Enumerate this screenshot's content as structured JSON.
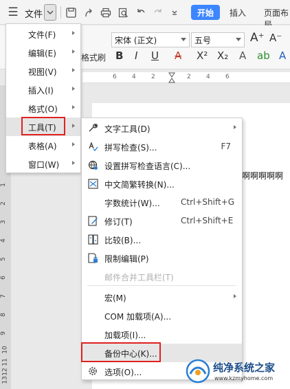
{
  "toolbar": {
    "file_label": "文件",
    "start_tab": "开始",
    "insert_tab": "插入",
    "layout_tab": "页面布局",
    "accent_color": "#3c86ff"
  },
  "ribbon": {
    "font_name": "宋体 (正文)",
    "font_size": "五号",
    "format_brush_label": "格式刷",
    "bold": "B",
    "italic": "I",
    "underline": "U",
    "grow_font": "A⁺",
    "shrink_font": "A⁻",
    "superscript": "X²",
    "subscript": "X₂"
  },
  "ruler": {
    "h_ticks": [
      "6",
      "4",
      "2",
      "2",
      "4",
      "6"
    ],
    "v_ticks": [
      "1",
      "2",
      "3",
      "4",
      "5",
      "6",
      "7",
      "8",
      "9",
      "10",
      "11",
      "12",
      "13",
      "14",
      "15"
    ]
  },
  "document": {
    "text": "啊啊啊啊啊"
  },
  "file_menu": {
    "items": [
      {
        "label": "文件(F)"
      },
      {
        "label": "编辑(E)"
      },
      {
        "label": "视图(V)"
      },
      {
        "label": "插入(I)"
      },
      {
        "label": "格式(O)"
      },
      {
        "label": "工具(T)",
        "active": true
      },
      {
        "label": "表格(A)"
      },
      {
        "label": "窗口(W)"
      }
    ]
  },
  "tools_menu": {
    "items": [
      {
        "label": "文字工具(D)",
        "icon": "wrench-icon",
        "submenu": true
      },
      {
        "label": "拼写检查(S)...",
        "icon": "spell-check-icon",
        "shortcut": "F7"
      },
      {
        "label": "设置拼写检查语言(C)...",
        "icon": "language-globe-icon"
      },
      {
        "label": "中文简繁转换(N)...",
        "icon": "chinese-convert-icon"
      },
      {
        "label": "字数统计(W)...",
        "shortcut": "Ctrl+Shift+G"
      },
      {
        "label": "修订(T)",
        "icon": "track-changes-icon",
        "shortcut": "Ctrl+Shift+E"
      },
      {
        "label": "比较(B)...",
        "icon": "compare-icon"
      },
      {
        "label": "限制编辑(P)",
        "icon": "restrict-edit-icon"
      },
      {
        "label": "邮件合并工具栏(T)",
        "disabled": true
      },
      {
        "label": "宏(M)",
        "submenu": true
      },
      {
        "label": "COM 加载项(A)..."
      },
      {
        "label": "加载项(I)..."
      },
      {
        "label": "备份中心(K)...",
        "highlighted": true
      },
      {
        "label": "选项(O)...",
        "icon": "gear-icon"
      }
    ]
  },
  "watermark": {
    "title": "纯净系统之家",
    "url": "www.kzmyhome.com"
  },
  "colors": {
    "highlight_box": "#e02020",
    "watermark_blue": "#1d4e8a"
  }
}
